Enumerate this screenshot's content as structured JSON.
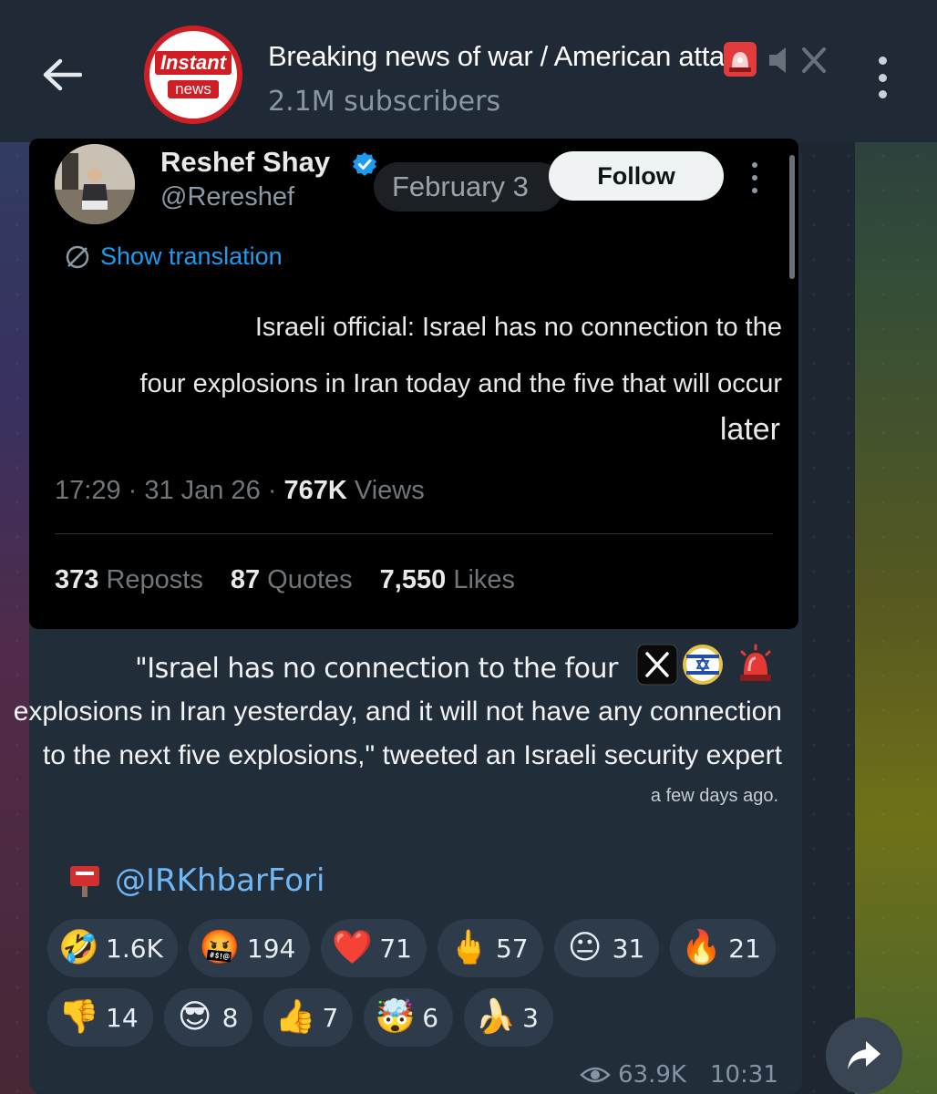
{
  "header": {
    "channel_title": "Breaking news of war / American attack",
    "subscribers": "2.1M subscribers",
    "logo_top": "Instant",
    "logo_bottom": "news"
  },
  "tweet": {
    "author_name": "Reshef Shay",
    "author_handle": "@Rereshef",
    "date_pill": "February 3",
    "follow_label": "Follow",
    "show_translation": "Show translation",
    "text_lines": [
      "Israeli official: Israel has no connection to the",
      "four explosions in Iran today and the five that will occur"
    ],
    "text_last": "later",
    "time": "17:29",
    "date": "31 Jan 26",
    "views_count": "767K",
    "views_label": "Views",
    "reposts_count": "373",
    "reposts_label": "Reposts",
    "quotes_count": "87",
    "quotes_label": "Quotes",
    "likes_count": "7,550",
    "likes_label": "Likes"
  },
  "caption": {
    "line1": "\"Israel has no connection to the four",
    "line2": "explosions in Iran yesterday, and it will not have any connection",
    "line3": "to the next five explosions,\" tweeted an Israeli security expert",
    "time_note": "a few days ago.",
    "mention": "@IRKhbarFori"
  },
  "reactions": [
    {
      "emoji": "🤣",
      "count": "1.6K",
      "name": "reaction-rofl"
    },
    {
      "emoji": "🤬",
      "count": "194",
      "name": "reaction-cursing"
    },
    {
      "emoji": "❤️",
      "count": "71",
      "name": "reaction-heart"
    },
    {
      "emoji": "🖕",
      "count": "57",
      "name": "reaction-middle-finger"
    },
    {
      "emoji": "😐",
      "count": "31",
      "name": "reaction-neutral"
    },
    {
      "emoji": "🔥",
      "count": "21",
      "name": "reaction-fire"
    },
    {
      "emoji": "👎",
      "count": "14",
      "name": "reaction-thumbs-down"
    },
    {
      "emoji": "😎",
      "count": "8",
      "name": "reaction-sunglasses"
    },
    {
      "emoji": "👍",
      "count": "7",
      "name": "reaction-thumbs-up"
    },
    {
      "emoji": "🤯",
      "count": "6",
      "name": "reaction-mind-blown"
    },
    {
      "emoji": "🍌",
      "count": "3",
      "name": "reaction-banana"
    }
  ],
  "footer": {
    "views": "63.9K",
    "time": "10:31"
  },
  "colors": {
    "header_bg": "#1f2a36",
    "bubble_bg": "#222d3a",
    "link": "#70b7f5",
    "twitter_blue": "#1d9bf0",
    "logo_red": "#cf1f24"
  },
  "icons": [
    "back-arrow-icon",
    "siren-icon",
    "mute-icon",
    "more-vertical-icon",
    "verified-icon",
    "translate-icon",
    "x-logo-icon",
    "israel-flag-icon",
    "mailbox-icon",
    "eye-icon",
    "share-icon"
  ]
}
